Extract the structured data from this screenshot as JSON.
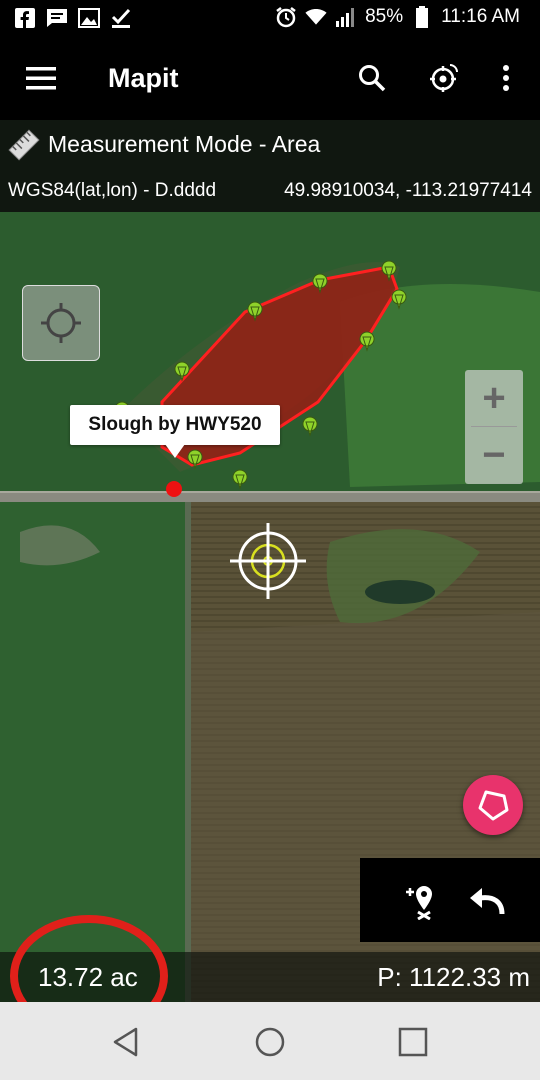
{
  "status_bar": {
    "notification_icons": [
      "facebook-icon",
      "message-icon",
      "image-icon",
      "checkmark-icon"
    ],
    "system_icons": [
      "alarm-icon",
      "wifi-icon",
      "signal-icon"
    ],
    "battery": "85%",
    "time": "11:16 AM"
  },
  "app_bar": {
    "title": "Mapit",
    "icons": [
      "menu-icon",
      "search-icon",
      "gps-satellite-icon",
      "more-vert-icon"
    ]
  },
  "mode_bar": {
    "icon": "ruler-icon",
    "text": "Measurement Mode - Area"
  },
  "coord_bar": {
    "system": "WGS84(lat,lon) - D.dddd",
    "value": "49.98910034, -113.21977414"
  },
  "map": {
    "label": "Slough by HWY520",
    "zoom_in": "+",
    "zoom_out": "−",
    "colors": {
      "polygon_stroke": "#ff2020",
      "polygon_fill": "#a01812",
      "marker": "#8fd22a",
      "fab": "#e8336c"
    }
  },
  "tools": {
    "add_point_icon": "add-location-icon",
    "undo_icon": "undo-icon",
    "fab_icon": "polygon-icon"
  },
  "readout": {
    "area": "13.72 ac",
    "perimeter": "P: 1122.33 m"
  },
  "nav_bar": {
    "icons": [
      "back-icon",
      "home-icon",
      "recents-icon"
    ]
  }
}
